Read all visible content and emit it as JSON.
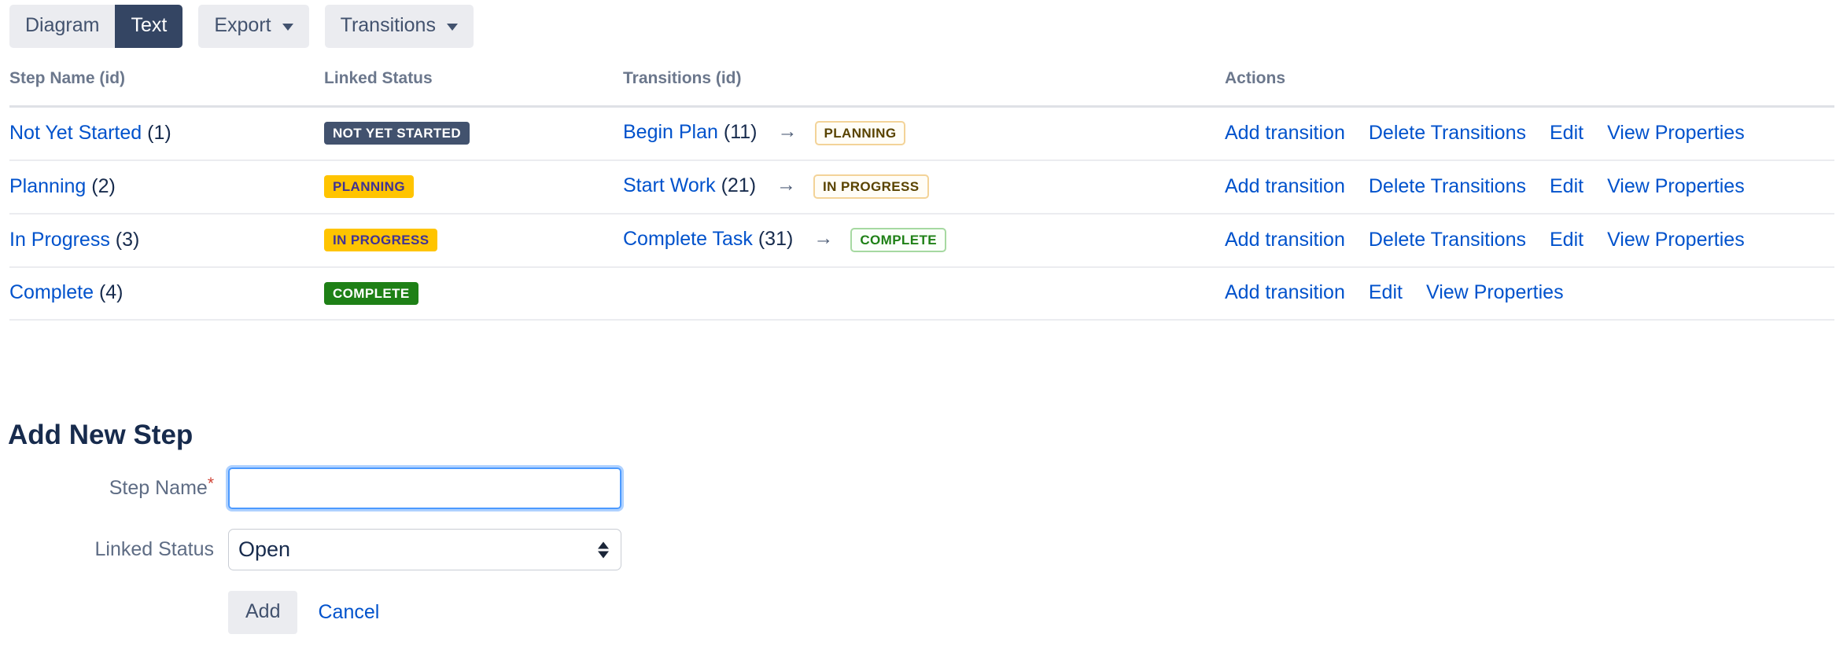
{
  "toolbar": {
    "tabs": [
      {
        "label": "Diagram",
        "active": false
      },
      {
        "label": "Text",
        "active": true
      }
    ],
    "export_label": "Export",
    "transitions_label": "Transitions"
  },
  "table": {
    "headers": {
      "step_name": "Step Name (id)",
      "linked_status": "Linked Status",
      "transitions": "Transitions (id)",
      "actions": "Actions"
    },
    "rows": [
      {
        "step_name": "Not Yet Started",
        "step_id": "(1)",
        "linked_status": "NOT YET STARTED",
        "linked_status_style": "loz-blue-grey",
        "transition_name": "Begin Plan",
        "transition_id": "(11)",
        "arrow": "→",
        "transition_target": "PLANNING",
        "transition_target_style": "loz-o-yellow",
        "actions": [
          "Add transition",
          "Delete Transitions",
          "Edit",
          "View Properties"
        ]
      },
      {
        "step_name": "Planning",
        "step_id": "(2)",
        "linked_status": "PLANNING",
        "linked_status_style": "loz-yellow",
        "transition_name": "Start Work",
        "transition_id": "(21)",
        "arrow": "→",
        "transition_target": "IN PROGRESS",
        "transition_target_style": "loz-o-yellow",
        "actions": [
          "Add transition",
          "Delete Transitions",
          "Edit",
          "View Properties"
        ]
      },
      {
        "step_name": "In Progress",
        "step_id": "(3)",
        "linked_status": "IN PROGRESS",
        "linked_status_style": "loz-yellow",
        "transition_name": "Complete Task",
        "transition_id": "(31)",
        "arrow": "→",
        "transition_target": "COMPLETE",
        "transition_target_style": "loz-o-green",
        "actions": [
          "Add transition",
          "Delete Transitions",
          "Edit",
          "View Properties"
        ]
      },
      {
        "step_name": "Complete",
        "step_id": "(4)",
        "linked_status": "COMPLETE",
        "linked_status_style": "loz-green",
        "transition_name": "",
        "transition_id": "",
        "arrow": "",
        "transition_target": "",
        "transition_target_style": "",
        "actions": [
          "Add transition",
          "Edit",
          "View Properties"
        ]
      }
    ]
  },
  "add_form": {
    "heading": "Add New Step",
    "step_name_label": "Step Name",
    "required_marker": "*",
    "step_name_value": "",
    "step_name_placeholder": "",
    "linked_status_label": "Linked Status",
    "linked_status_value": "Open",
    "linked_status_options": [
      "Open"
    ],
    "add_label": "Add",
    "cancel_label": "Cancel"
  },
  "colors": {
    "link": "#0052cc",
    "active_tab_bg": "#344563",
    "tab_bg": "#ebecf0",
    "status_not_yet_started": "#42526e",
    "status_planning": "#ffc400",
    "status_complete": "#1e8016",
    "required": "#d04437",
    "focus_ring": "#4c9aff"
  }
}
